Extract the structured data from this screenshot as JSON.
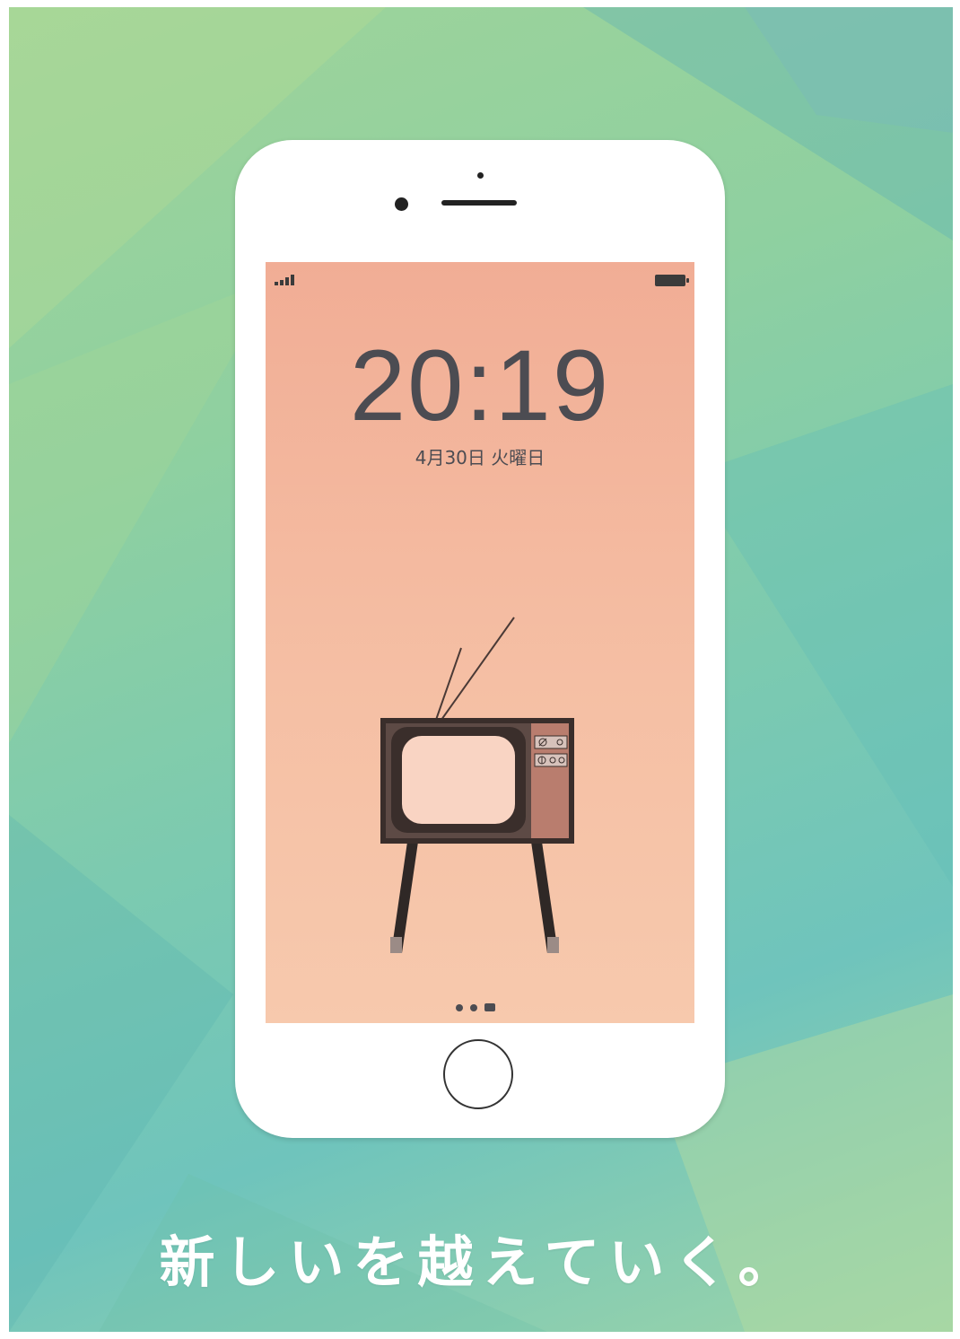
{
  "lock_screen": {
    "time": "20:19",
    "date": "4月30日 火曜日",
    "status_icons": [
      "signal-bars-icon",
      "battery-icon"
    ],
    "page_indicator": [
      "dot",
      "dot",
      "camera-icon"
    ]
  },
  "tagline": "新しいを越えていく。",
  "colors": {
    "background_green": "#8fd0a0",
    "background_teal": "#6fc4bc",
    "wallpaper": "#f5bfa4",
    "tv_frame": "#3a2e2b",
    "tv_screen": "#f9d4c3",
    "tv_panel": "#b97d6e",
    "text_dark": "#4c4c52"
  }
}
